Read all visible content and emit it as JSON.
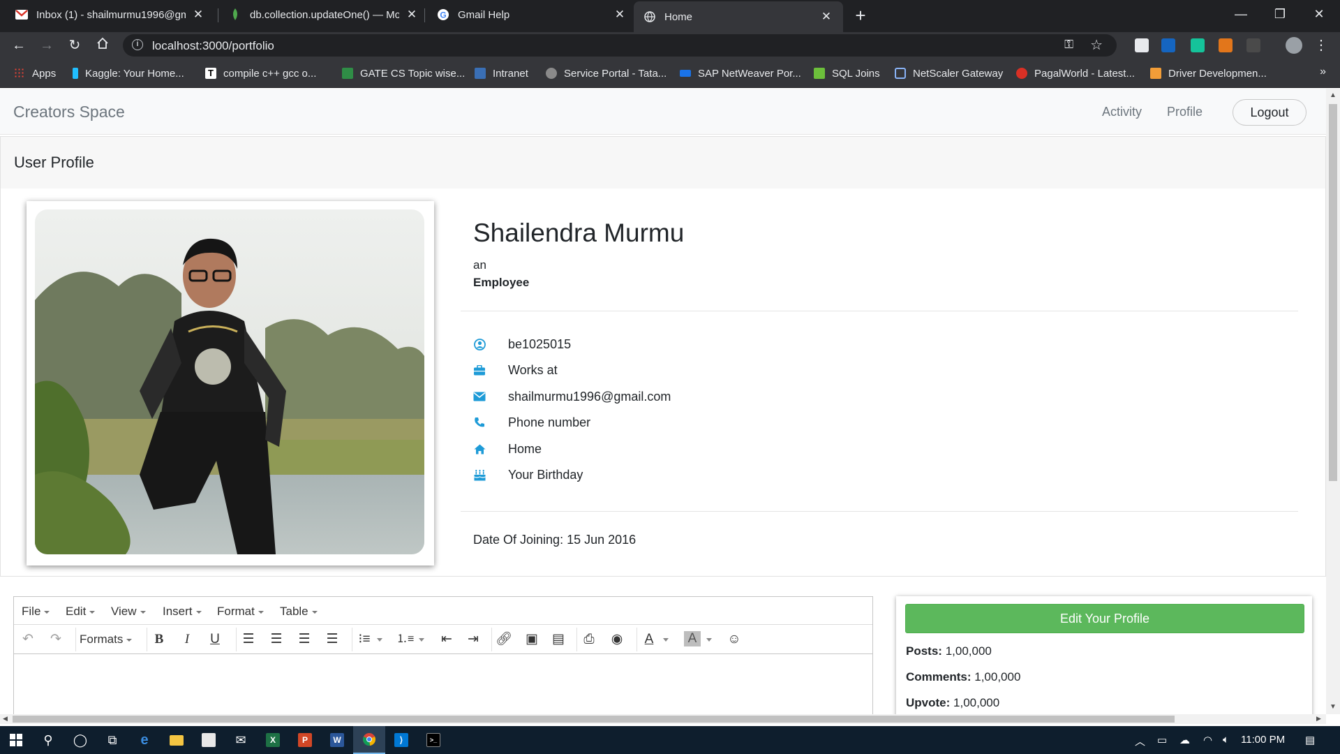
{
  "browser": {
    "tabs": [
      {
        "title": "Inbox (1) - shailmurmu1996@gm",
        "icon": "gmail-icon",
        "active": false
      },
      {
        "title": "db.collection.updateOne() — Mo",
        "icon": "mongodb-leaf-icon",
        "active": false
      },
      {
        "title": "Gmail Help",
        "icon": "google-g-icon",
        "active": false
      },
      {
        "title": "Home",
        "icon": "globe-icon",
        "active": true
      }
    ],
    "url": "localhost:3000/portfolio",
    "bookmarks": [
      {
        "label": "Apps",
        "color": "#e9a23b"
      },
      {
        "label": "Kaggle: Your Home...",
        "color": "#20beff"
      },
      {
        "label": "compile c++ gcc o...",
        "color": "#ffffff"
      },
      {
        "label": "GATE CS Topic wise...",
        "color": "#2f8d46"
      },
      {
        "label": "Intranet",
        "color": "#3a6fb5"
      },
      {
        "label": "Service Portal - Tata...",
        "color": "#8a8a8a"
      },
      {
        "label": "SAP NetWeaver Por...",
        "color": "#1a73e8"
      },
      {
        "label": "SQL Joins",
        "color": "#6cbf3b"
      },
      {
        "label": "NetScaler Gateway",
        "color": "#8ab4f8"
      },
      {
        "label": "PagalWorld - Latest...",
        "color": "#d93025"
      },
      {
        "label": "Driver Developmen...",
        "color": "#f29d38"
      }
    ]
  },
  "navbar": {
    "brand": "Creators Space",
    "links": [
      "Activity",
      "Profile"
    ],
    "logout": "Logout"
  },
  "profile": {
    "header": "User Profile",
    "name": "Shailendra Murmu",
    "an": "an",
    "role": "Employee",
    "details": [
      {
        "icon": "user-circle-icon",
        "text": "be1025015"
      },
      {
        "icon": "briefcase-icon",
        "text": "Works at"
      },
      {
        "icon": "envelope-icon",
        "text": "shailmurmu1996@gmail.com"
      },
      {
        "icon": "phone-icon",
        "text": "Phone number"
      },
      {
        "icon": "home-icon",
        "text": "Home"
      },
      {
        "icon": "birthday-cake-icon",
        "text": "Your Birthday"
      }
    ],
    "date_of_joining": "Date Of Joining: 15 Jun 2016"
  },
  "editor": {
    "menus": [
      "File",
      "Edit",
      "View",
      "Insert",
      "Format",
      "Table"
    ],
    "formats_label": "Formats"
  },
  "stats": {
    "edit_button": "Edit Your Profile",
    "items": [
      {
        "label": "Posts:",
        "value": "1,00,000"
      },
      {
        "label": "Comments:",
        "value": "1,00,000"
      },
      {
        "label": "Upvote:",
        "value": "1,00,000"
      }
    ]
  },
  "taskbar": {
    "time": "11:00 PM"
  },
  "colors": {
    "accent_icon": "#1e9bd7",
    "edit_button": "#5cb85c",
    "taskbar": "#0e1e2d"
  }
}
